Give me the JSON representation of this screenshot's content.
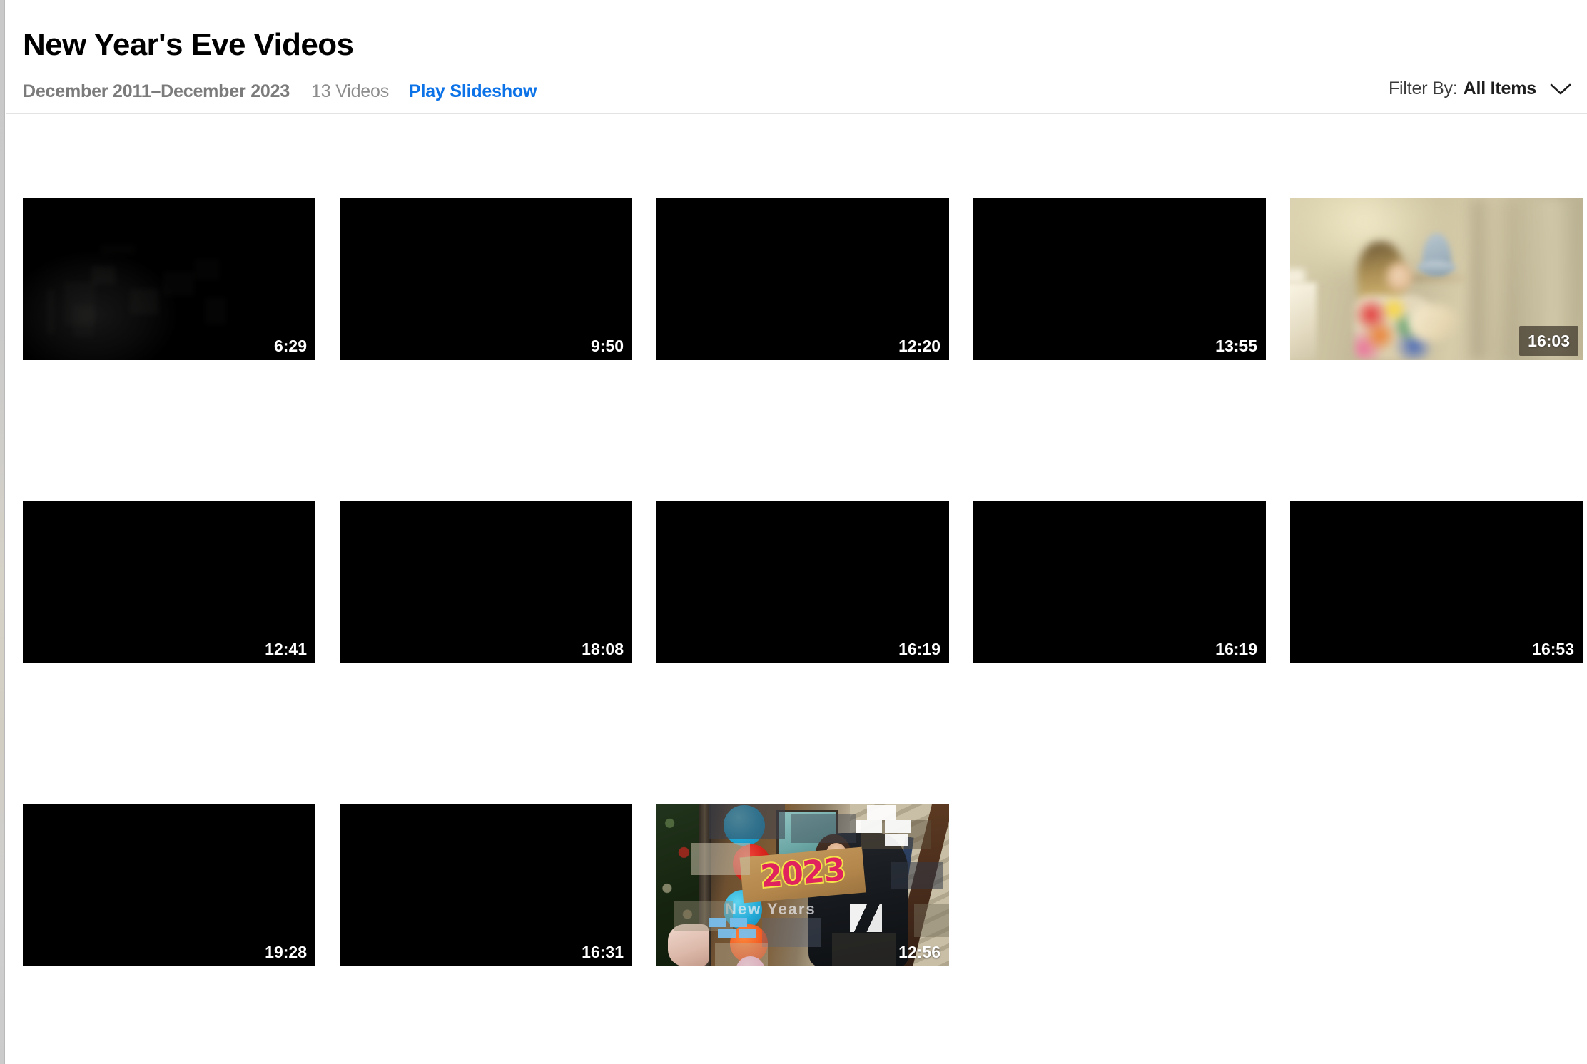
{
  "window": {
    "background_color": "#ffffff",
    "edge_color": "#cacaca"
  },
  "header": {
    "title": "New Year's Eve Videos",
    "date_range": "December 2011–December 2023",
    "video_count": "13 Videos",
    "play_slideshow_label": "Play Slideshow",
    "play_slideshow_color": "#0b72e7",
    "filter": {
      "label": "Filter By:",
      "value": "All Items",
      "chevron_icon": "chevron-down-icon"
    }
  },
  "grid": {
    "columns": 5,
    "rows": 3,
    "items": [
      {
        "index": 1,
        "duration": "6:29",
        "thumb_style": "dark-room",
        "badge": false,
        "description": "Very dark indoor scene, faint furniture silhouettes"
      },
      {
        "index": 2,
        "duration": "9:50",
        "thumb_style": "black",
        "badge": false,
        "description": "Black frame"
      },
      {
        "index": 3,
        "duration": "12:20",
        "thumb_style": "black",
        "badge": false,
        "description": "Black frame"
      },
      {
        "index": 4,
        "duration": "13:55",
        "thumb_style": "black",
        "badge": false,
        "description": "Black frame"
      },
      {
        "index": 5,
        "duration": "16:03",
        "thumb_style": "child-blur",
        "badge": true,
        "description": "Blurry child with blonde hair in colorful shirt, beige wall, lamp"
      },
      {
        "index": 6,
        "duration": "12:41",
        "thumb_style": "black",
        "badge": false,
        "description": "Black frame"
      },
      {
        "index": 7,
        "duration": "18:08",
        "thumb_style": "black",
        "badge": false,
        "description": "Black frame"
      },
      {
        "index": 8,
        "duration": "16:19",
        "thumb_style": "black",
        "badge": false,
        "description": "Black frame"
      },
      {
        "index": 9,
        "duration": "16:19",
        "thumb_style": "black",
        "badge": false,
        "description": "Black frame"
      },
      {
        "index": 10,
        "duration": "16:53",
        "thumb_style": "black",
        "badge": false,
        "description": "Black frame"
      },
      {
        "index": 11,
        "duration": "19:28",
        "thumb_style": "black",
        "badge": false,
        "description": "Black frame"
      },
      {
        "index": 12,
        "duration": "16:31",
        "thumb_style": "black",
        "badge": false,
        "description": "Black frame"
      },
      {
        "index": 13,
        "duration": "12:56",
        "thumb_style": "nye-2023",
        "badge": false,
        "description": "Person holding 2023 sign with balloons, Christmas tree and staircase"
      }
    ],
    "nye_thumb": {
      "sign_text": "2023",
      "overlay_text": "New Years"
    }
  }
}
